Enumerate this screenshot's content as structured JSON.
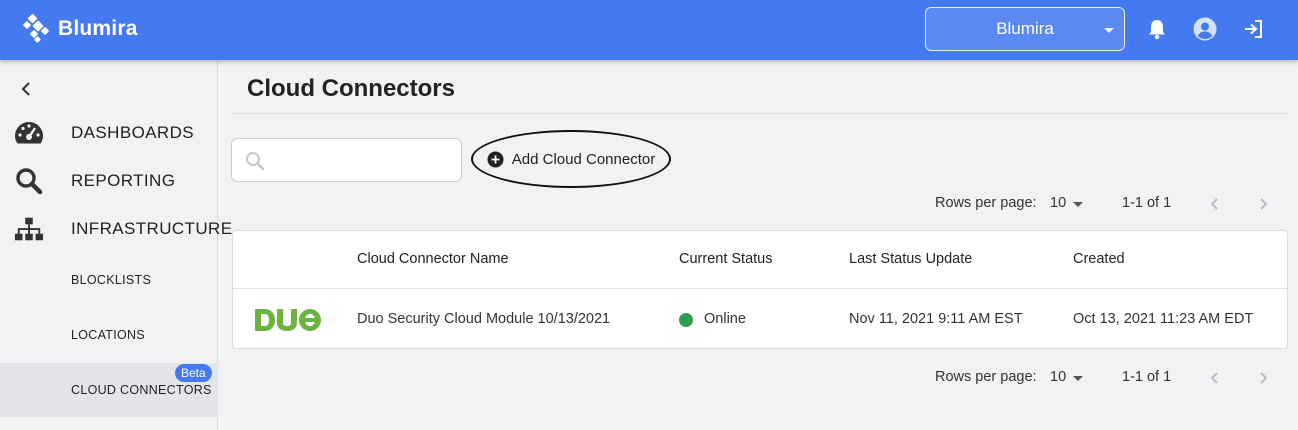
{
  "header": {
    "brand": "Blumira",
    "org_selector": "Blumira",
    "colors": {
      "bar": "#4479f0",
      "accent": "#4479f0"
    },
    "icons": [
      "bell-icon",
      "account-icon",
      "logout-icon"
    ]
  },
  "sidebar": {
    "collapse_icon": "chevron-left-icon",
    "items": [
      {
        "label": "DASHBOARDS",
        "icon": "speedometer-icon"
      },
      {
        "label": "REPORTING",
        "icon": "search-icon"
      },
      {
        "label": "INFRASTRUCTURE",
        "icon": "sitemap-icon"
      }
    ],
    "sub_items": [
      {
        "label": "BLOCKLISTS"
      },
      {
        "label": "LOCATIONS"
      },
      {
        "label": "CLOUD CONNECTORS",
        "badge": "Beta",
        "active": true
      }
    ]
  },
  "main": {
    "title": "Cloud Connectors",
    "search": {
      "placeholder": ""
    },
    "add_button": "Add Cloud Connector",
    "pagination": {
      "rows_per_page_label": "Rows per page:",
      "rows_per_page": "10",
      "range": "1-1 of 1"
    },
    "table": {
      "columns": [
        "Cloud Connector Name",
        "Current Status",
        "Last Status Update",
        "Created"
      ],
      "rows": [
        {
          "logo": "DUO",
          "name": "Duo Security Cloud Module 10/13/2021",
          "status": "Online",
          "status_color": "#2e9e52",
          "last_update": "Nov 11, 2021 9:11 AM EST",
          "created": "Oct 13, 2021 11:23 AM EDT"
        }
      ]
    }
  }
}
